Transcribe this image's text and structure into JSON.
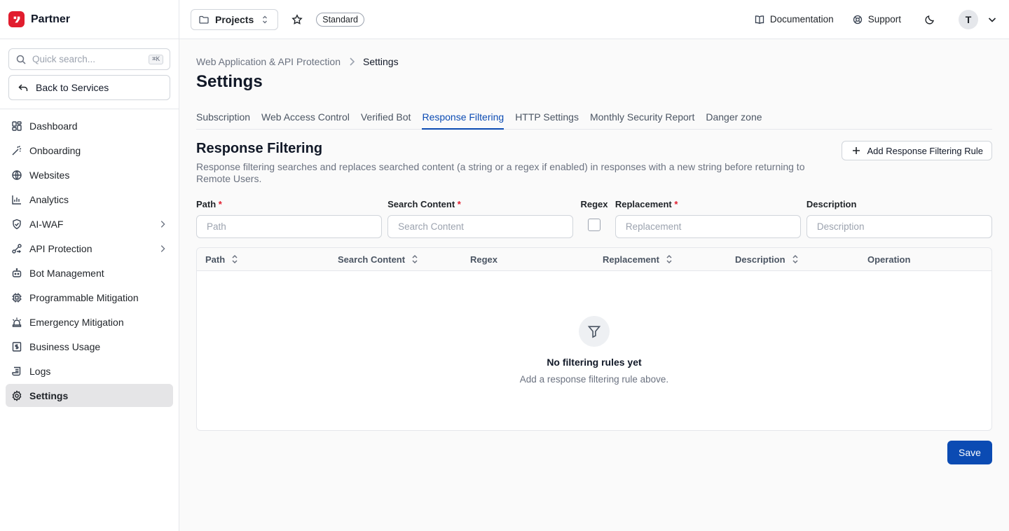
{
  "brand": {
    "name": "Partner",
    "accent": "#e11d2e"
  },
  "sidebar": {
    "search_placeholder": "Quick search...",
    "search_shortcut": "⌘K",
    "back_label": "Back to Services",
    "items": [
      {
        "label": "Dashboard",
        "icon": "dashboard-icon"
      },
      {
        "label": "Onboarding",
        "icon": "wand-icon"
      },
      {
        "label": "Websites",
        "icon": "globe-icon"
      },
      {
        "label": "Analytics",
        "icon": "bar-chart-icon"
      },
      {
        "label": "AI-WAF",
        "icon": "shield-icon",
        "has_children": true
      },
      {
        "label": "API Protection",
        "icon": "api-icon",
        "has_children": true
      },
      {
        "label": "Bot Management",
        "icon": "bot-icon"
      },
      {
        "label": "Programmable Mitigation",
        "icon": "cpu-icon"
      },
      {
        "label": "Emergency Mitigation",
        "icon": "siren-icon"
      },
      {
        "label": "Business Usage",
        "icon": "receipt-icon"
      },
      {
        "label": "Logs",
        "icon": "scroll-icon"
      },
      {
        "label": "Settings",
        "icon": "gear-icon",
        "active": true
      }
    ]
  },
  "topbar": {
    "project_label": "Projects",
    "plan_badge": "Standard",
    "documentation_label": "Documentation",
    "support_label": "Support",
    "avatar_initial": "T"
  },
  "breadcrumb": {
    "parent": "Web Application & API Protection",
    "current": "Settings"
  },
  "page_title": "Settings",
  "tabs": [
    {
      "label": "Subscription"
    },
    {
      "label": "Web Access Control"
    },
    {
      "label": "Verified Bot"
    },
    {
      "label": "Response Filtering",
      "active": true
    },
    {
      "label": "HTTP Settings"
    },
    {
      "label": "Monthly Security Report"
    },
    {
      "label": "Danger zone"
    }
  ],
  "section": {
    "title": "Response Filtering",
    "description": "Response filtering searches and replaces searched content (a string or a regex if enabled) in responses with a new string before returning to Remote Users.",
    "add_button": "Add Response Filtering Rule"
  },
  "form": {
    "path_label": "Path",
    "path_placeholder": "Path",
    "search_label": "Search Content",
    "search_placeholder": "Search Content",
    "regex_label": "Regex",
    "replacement_label": "Replacement",
    "replacement_placeholder": "Replacement",
    "description_label": "Description",
    "description_placeholder": "Description",
    "required_mark": "*"
  },
  "table": {
    "columns": [
      {
        "label": "Path",
        "sortable": true
      },
      {
        "label": "Search Content",
        "sortable": true
      },
      {
        "label": "Regex",
        "sortable": false
      },
      {
        "label": "Replacement",
        "sortable": true
      },
      {
        "label": "Description",
        "sortable": true
      },
      {
        "label": "Operation",
        "sortable": false
      }
    ],
    "empty_title": "No filtering rules yet",
    "empty_subtitle": "Add a response filtering rule above."
  },
  "save_label": "Save",
  "colors": {
    "primary": "#0b4bb3",
    "active_nav_bg": "#e5e5e7"
  }
}
